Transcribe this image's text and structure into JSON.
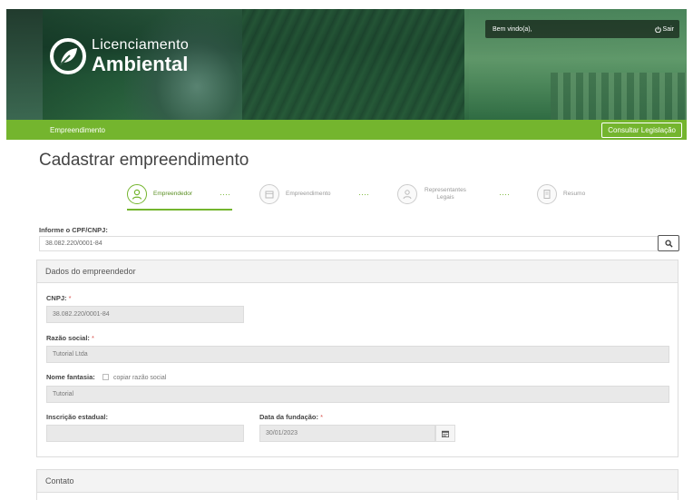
{
  "header": {
    "logo_line1": "Licenciamento",
    "logo_line2": "Ambiental",
    "welcome": "Bem vindo(a),",
    "logout_label": "Sair"
  },
  "nav": {
    "link_label": "Empreendimento",
    "legislation_button": "Consultar Legislação"
  },
  "page": {
    "title": "Cadastrar empreendimento"
  },
  "stepper": {
    "steps": [
      {
        "label": "Empreendedor",
        "active": true
      },
      {
        "label": "Empreendimento",
        "active": false
      },
      {
        "label": "Representantes Legais",
        "active": false
      },
      {
        "label": "Resumo",
        "active": false
      }
    ],
    "separator": "····"
  },
  "search": {
    "label": "Informe o CPF/CNPJ:",
    "value": "38.082.220/0001-84",
    "icon": "search-icon"
  },
  "form": {
    "section_title": "Dados do empreendedor",
    "cnpj_label": "CNPJ:",
    "cnpj_value": "38.082.220/0001-84",
    "razao_label": "Razão social:",
    "razao_value": "Tutorial Ltda",
    "fantasia_label": "Nome fantasia:",
    "copy_label": "copiar razão social",
    "fantasia_value": "Tutorial",
    "inscricao_label": "Inscrição estadual:",
    "inscricao_value": "",
    "fundacao_label": "Data da fundação:",
    "fundacao_value": "30/01/2023",
    "required_mark": "*"
  },
  "contact": {
    "section_title": "Contato"
  },
  "colors": {
    "accent": "#74b52e",
    "required": "#d9534f"
  }
}
